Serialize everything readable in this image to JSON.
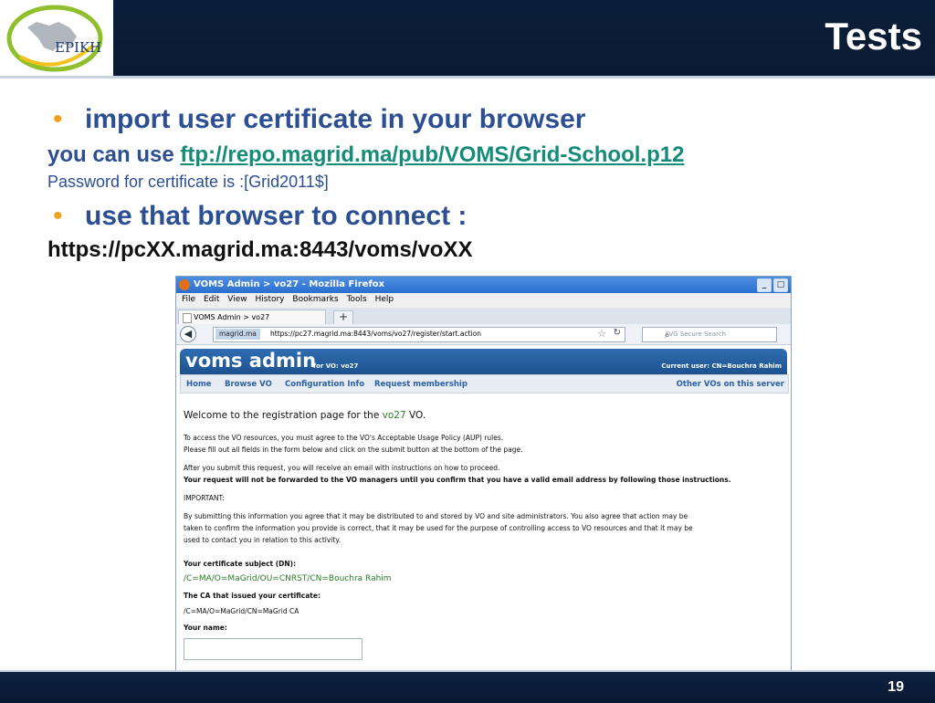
{
  "header": {
    "logo_text": "EPIKH",
    "title": "Tests"
  },
  "slide": {
    "bullet1": "import user certificate in your browser",
    "use_prefix": "you can use ",
    "use_link": "ftp://repo.magrid.ma/pub/VOMS/Grid-School.p12",
    "password_line": "Password for certificate is :[Grid2011$]",
    "bullet2": "use that browser to connect :",
    "connect_url": "https://pcXX.magrid.ma:8443/voms/voXX"
  },
  "browser": {
    "window_title": "VOMS Admin > vo27 - Mozilla Firefox",
    "menu": [
      "File",
      "Edit",
      "View",
      "History",
      "Bookmarks",
      "Tools",
      "Help"
    ],
    "tab_label": "VOMS Admin > vo27",
    "site_identity": "magrid.ma",
    "url": "https://pc27.magrid.ma:8443/voms/vo27/register/start.action",
    "search_placeholder": "AVG Secure Search"
  },
  "voms": {
    "banner_title": "voms admin",
    "for_vo": "for VO: vo27",
    "current_user": "Current user: CN=Bouchra Rahim",
    "nav": [
      "Home",
      "Browse VO",
      "Configuration Info",
      "Request membership"
    ],
    "nav_right": "Other VOs on this server",
    "welcome_prefix": "Welcome to the registration page for the ",
    "welcome_vo": "vo27",
    "welcome_suffix": " VO.",
    "p1": "To access the VO resources, you must agree to the VO's Acceptable Usage Policy (AUP) rules.",
    "p2": "Please fill out all fields in the form below and click on the submit button at the bottom of the page.",
    "p3": "After you submit this request, you will receive an email with instructions on how to proceed.",
    "p4": "Your request will not be forwarded to the VO managers until you confirm that you have a valid email address by following those instructions.",
    "important": "IMPORTANT:",
    "p5": "By submitting this information you agree that it may be distributed to and stored by VO and site administrators. You also agree that action may be",
    "p6": "taken to confirm the information you provide is correct, that it may be used for the purpose of controlling access to VO resources and that it may be",
    "p7": "used to contact you in relation to this activity.",
    "dn_label": "Your certificate subject (DN):",
    "dn_value": "/C=MA/O=MaGrid/OU=CNRST/CN=Bouchra Rahim",
    "ca_label": "The CA that issued your certificate:",
    "ca_value": "/C=MA/O=MaGrid/CN=MaGrid CA",
    "name_label": "Your name:",
    "name_value": ""
  },
  "footer": {
    "page_number": "19"
  }
}
